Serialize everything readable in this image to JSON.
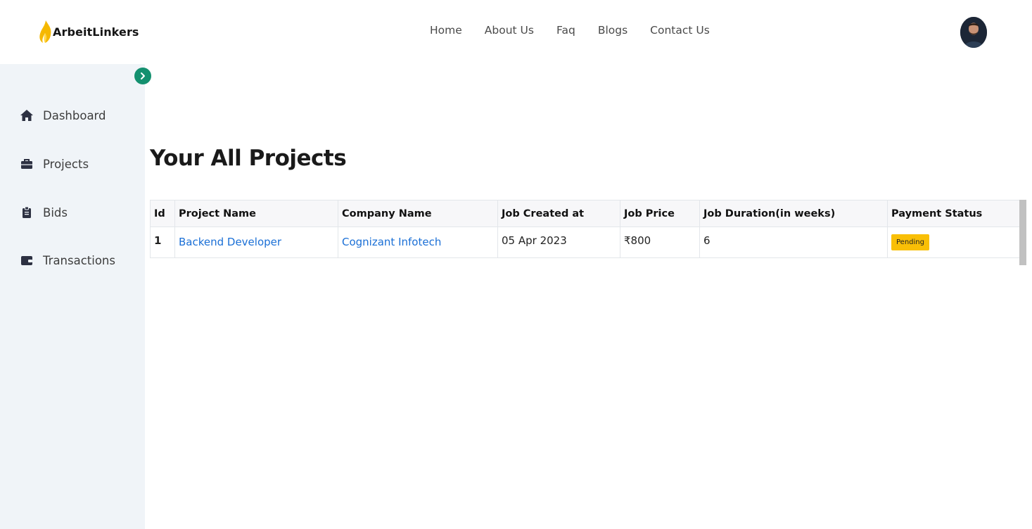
{
  "header": {
    "brand": "ArbeitLinkers",
    "nav": [
      "Home",
      "About Us",
      "Faq",
      "Blogs",
      "Contact Us"
    ]
  },
  "sidebar": {
    "items": [
      {
        "label": "Dashboard",
        "icon": "home-icon"
      },
      {
        "label": "Projects",
        "icon": "briefcase-icon"
      },
      {
        "label": "Bids",
        "icon": "clipboard-icon"
      },
      {
        "label": "Transactions",
        "icon": "wallet-icon"
      }
    ]
  },
  "main": {
    "title": "Your All Projects",
    "table": {
      "columns": [
        "Id",
        "Project Name",
        "Company Name",
        "Job Created at",
        "Job Price",
        "Job Duration(in weeks)",
        "Payment Status"
      ],
      "rows": [
        {
          "id": "1",
          "project": "Backend Developer",
          "company": "Cognizant Infotech",
          "created": "05 Apr 2023",
          "price": "₹800",
          "duration": "6",
          "status": "Pending"
        }
      ]
    }
  },
  "colors": {
    "accent": "#14906f",
    "link": "#1a6fd6",
    "badge": "#f9bf06",
    "sidebar_bg": "#f0f4f8",
    "logo": "#f5b800"
  }
}
